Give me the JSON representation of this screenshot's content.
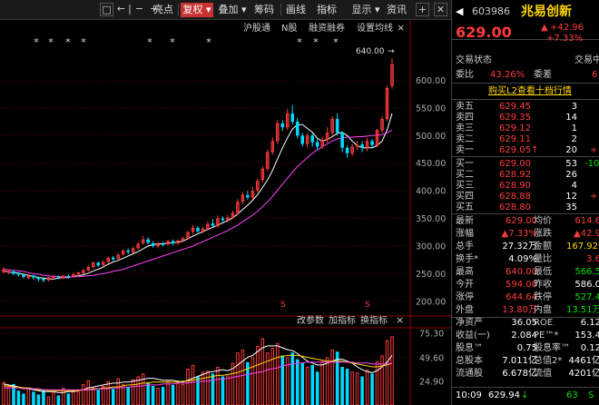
{
  "toolbar": {
    "nav_icons": [
      "□",
      "←",
      "|",
      "−",
      "+"
    ],
    "buttons": [
      "亮点",
      "复权 ▾",
      "叠加 ▾",
      "筹码",
      "画线",
      "指标",
      "显示 ▾",
      "资讯"
    ],
    "active_button": "复权 ▾",
    "plus_icon": "+",
    "close_icon": "✕"
  },
  "chart_header": {
    "stars": [
      "*",
      "*",
      "*",
      "*",
      "*",
      "*",
      "*",
      "*",
      "*",
      "*"
    ],
    "events": [
      "沪股通",
      "N股",
      "融资融券",
      "设置均线"
    ],
    "close_label": "×",
    "high_label": "640.00",
    "high_arrow": "→"
  },
  "indicator_menu": {
    "items": [
      "改参数",
      "加指标",
      "换指标"
    ],
    "close": "×"
  },
  "s_markers": [
    "S",
    "S"
  ],
  "colors": {
    "up": "#ff3b3b",
    "down": "#00d8ff",
    "ma5": "#ffffff",
    "ma10": "#ffd700",
    "ma20": "#ff40ff",
    "background": "#000000",
    "grid": "#8b0000"
  },
  "chart_data": {
    "type": "candlestick",
    "ylim": [
      175,
      660
    ],
    "price_ticks": [
      "600.00",
      "550.00",
      "500.00",
      "450.00",
      "400.00",
      "350.00",
      "300.00",
      "250.00",
      "200.00"
    ],
    "volume_ticks": [
      "75.30",
      "49.60",
      "24.90"
    ],
    "candles": [
      [
        253,
        258,
        250,
        262,
        0
      ],
      [
        252,
        255,
        249,
        258,
        0
      ],
      [
        254,
        250,
        247,
        257,
        1
      ],
      [
        251,
        248,
        245,
        253,
        1
      ],
      [
        248,
        244,
        241,
        250,
        1
      ],
      [
        242,
        246,
        240,
        249,
        0
      ],
      [
        247,
        243,
        239,
        248,
        1
      ],
      [
        243,
        240,
        236,
        245,
        1
      ],
      [
        241,
        238,
        234,
        243,
        1
      ],
      [
        238,
        243,
        236,
        245,
        0
      ],
      [
        243,
        245,
        239,
        248,
        0
      ],
      [
        245,
        243,
        240,
        247,
        1
      ],
      [
        242,
        246,
        240,
        248,
        0
      ],
      [
        246,
        245,
        241,
        249,
        1
      ],
      [
        245,
        249,
        243,
        252,
        0
      ],
      [
        249,
        252,
        246,
        254,
        0
      ],
      [
        251,
        256,
        249,
        259,
        0
      ],
      [
        256,
        262,
        254,
        265,
        0
      ],
      [
        262,
        270,
        259,
        272,
        0
      ],
      [
        270,
        265,
        262,
        272,
        1
      ],
      [
        266,
        271,
        263,
        274,
        0
      ],
      [
        271,
        279,
        269,
        281,
        0
      ],
      [
        279,
        276,
        273,
        282,
        1
      ],
      [
        277,
        284,
        275,
        288,
        0
      ],
      [
        285,
        292,
        283,
        294,
        0
      ],
      [
        292,
        289,
        286,
        296,
        1
      ],
      [
        289,
        296,
        287,
        299,
        0
      ],
      [
        296,
        304,
        294,
        307,
        0
      ],
      [
        305,
        312,
        302,
        318,
        0
      ],
      [
        312,
        306,
        303,
        316,
        1
      ],
      [
        305,
        300,
        297,
        309,
        1
      ],
      [
        300,
        304,
        296,
        307,
        0
      ],
      [
        304,
        302,
        299,
        308,
        1
      ],
      [
        303,
        309,
        301,
        311,
        0
      ],
      [
        309,
        305,
        301,
        312,
        1
      ],
      [
        305,
        310,
        302,
        312,
        0
      ],
      [
        310,
        314,
        307,
        317,
        0
      ],
      [
        314,
        325,
        312,
        328,
        0
      ],
      [
        326,
        333,
        322,
        338,
        0
      ],
      [
        333,
        327,
        324,
        336,
        1
      ],
      [
        327,
        331,
        323,
        335,
        0
      ],
      [
        331,
        340,
        328,
        345,
        0
      ],
      [
        341,
        337,
        334,
        349,
        1
      ],
      [
        336,
        350,
        333,
        355,
        0
      ],
      [
        350,
        347,
        343,
        354,
        1
      ],
      [
        347,
        352,
        343,
        356,
        0
      ],
      [
        352,
        360,
        349,
        364,
        0
      ],
      [
        360,
        380,
        357,
        385,
        0
      ],
      [
        381,
        393,
        375,
        398,
        0
      ],
      [
        392,
        388,
        384,
        400,
        1
      ],
      [
        388,
        400,
        384,
        407,
        0
      ],
      [
        401,
        418,
        397,
        422,
        0
      ],
      [
        420,
        440,
        415,
        445,
        0
      ],
      [
        440,
        470,
        436,
        475,
        0
      ],
      [
        470,
        490,
        465,
        497,
        0
      ],
      [
        490,
        522,
        485,
        528,
        0
      ],
      [
        522,
        515,
        508,
        528,
        1
      ],
      [
        515,
        540,
        510,
        548,
        0
      ],
      [
        540,
        525,
        520,
        555,
        1
      ],
      [
        525,
        500,
        495,
        532,
        1
      ],
      [
        500,
        485,
        480,
        505,
        1
      ],
      [
        485,
        500,
        478,
        505,
        0
      ],
      [
        500,
        488,
        480,
        504,
        1
      ],
      [
        488,
        480,
        474,
        494,
        1
      ],
      [
        480,
        492,
        476,
        498,
        0
      ],
      [
        492,
        505,
        487,
        515,
        0
      ],
      [
        505,
        530,
        500,
        535,
        0
      ],
      [
        530,
        505,
        500,
        540,
        1
      ],
      [
        505,
        478,
        470,
        508,
        1
      ],
      [
        478,
        468,
        460,
        482,
        1
      ],
      [
        468,
        480,
        463,
        485,
        0
      ],
      [
        480,
        483,
        474,
        490,
        0
      ],
      [
        484,
        478,
        470,
        490,
        1
      ],
      [
        478,
        490,
        472,
        496,
        0
      ],
      [
        490,
        483,
        477,
        494,
        1
      ],
      [
        482,
        510,
        479,
        512,
        0
      ],
      [
        510,
        530,
        505,
        535,
        0
      ],
      [
        530,
        586,
        526,
        590,
        0
      ],
      [
        590,
        629,
        585,
        640,
        0
      ]
    ],
    "volumes": [
      24,
      20,
      22,
      15,
      12,
      18,
      14,
      11,
      16,
      9,
      13,
      10,
      18,
      12,
      15,
      14,
      22,
      26,
      18,
      16,
      20,
      25,
      17,
      28,
      22,
      19,
      27,
      30,
      33,
      24,
      20,
      18,
      19,
      26,
      21,
      24,
      22,
      38,
      42,
      30,
      35,
      36,
      33,
      40,
      30,
      31,
      44,
      55,
      58,
      45,
      50,
      62,
      70,
      55,
      60,
      65,
      52,
      50,
      55,
      48,
      44,
      40,
      42,
      35,
      46,
      50,
      58,
      56,
      40,
      38,
      35,
      34,
      30,
      37,
      33,
      46,
      52,
      68,
      72
    ],
    "ma5": [
      255,
      253,
      252,
      251,
      249,
      247,
      245,
      243,
      242,
      241,
      240,
      242,
      243,
      243,
      245,
      246,
      248,
      251,
      255,
      258,
      262,
      267,
      271,
      274,
      278,
      282,
      286,
      290,
      295,
      300,
      303,
      304,
      304,
      305,
      306,
      307,
      309,
      313,
      318,
      322,
      326,
      330,
      334,
      338,
      342,
      346,
      351,
      358,
      366,
      374,
      383,
      393,
      406,
      420,
      437,
      458,
      478,
      496,
      512,
      520,
      520,
      513,
      506,
      495,
      490,
      493,
      498,
      504,
      506,
      500,
      490,
      482,
      478,
      478,
      478,
      482,
      490,
      510,
      540
    ],
    "ma20": [
      258,
      257,
      256,
      255,
      254,
      252,
      250,
      249,
      247,
      246,
      245,
      245,
      244,
      244,
      244,
      245,
      245,
      246,
      247,
      249,
      250,
      252,
      254,
      256,
      258,
      261,
      264,
      267,
      270,
      273,
      276,
      279,
      282,
      285,
      288,
      291,
      294,
      297,
      300,
      304,
      308,
      312,
      316,
      320,
      324,
      328,
      333,
      338,
      344,
      350,
      356,
      363,
      371,
      380,
      390,
      401,
      412,
      423,
      434,
      444,
      452,
      460,
      468,
      474,
      480,
      485,
      490,
      494,
      496,
      497,
      497,
      498,
      498,
      499,
      500,
      501,
      502,
      505,
      510
    ],
    "vol_ma1": [
      22,
      21,
      20,
      19,
      18,
      17,
      16,
      15,
      14,
      14,
      14,
      13,
      13,
      14,
      14,
      15,
      16,
      18,
      19,
      20,
      21,
      22,
      23,
      23,
      24,
      24,
      25,
      26,
      27,
      28,
      28,
      27,
      26,
      26,
      26,
      25,
      24,
      26,
      28,
      30,
      32,
      34,
      35,
      36,
      37,
      36,
      38,
      42,
      46,
      50,
      52,
      56,
      60,
      62,
      62,
      62,
      60,
      58,
      57,
      54,
      50,
      46,
      44,
      42,
      42,
      44,
      46,
      48,
      48,
      46,
      44,
      40,
      37,
      35,
      34,
      36,
      40,
      45,
      52
    ],
    "vol_ma2": [
      20,
      20,
      19,
      19,
      18,
      18,
      17,
      16,
      16,
      15,
      15,
      15,
      15,
      15,
      15,
      15,
      16,
      16,
      17,
      17,
      18,
      18,
      19,
      19,
      20,
      21,
      21,
      22,
      23,
      23,
      24,
      24,
      24,
      24,
      24,
      24,
      25,
      25,
      26,
      27,
      28,
      29,
      30,
      31,
      31,
      32,
      33,
      34,
      36,
      38,
      40,
      42,
      44,
      46,
      48,
      50,
      51,
      52,
      52,
      52,
      51,
      50,
      49,
      48,
      47,
      46,
      46,
      46,
      46,
      45,
      44,
      43,
      42,
      41,
      40,
      40,
      41,
      42,
      44
    ],
    "vol_ma3": [
      18,
      18,
      18,
      18,
      17,
      17,
      17,
      17,
      16,
      16,
      16,
      16,
      16,
      16,
      16,
      16,
      16,
      16,
      16,
      17,
      17,
      17,
      18,
      18,
      18,
      19,
      19,
      20,
      20,
      21,
      21,
      21,
      22,
      22,
      22,
      23,
      23,
      23,
      24,
      24,
      25,
      25,
      26,
      27,
      27,
      28,
      29,
      30,
      31,
      32,
      33,
      34,
      35,
      37,
      38,
      39,
      41,
      42,
      43,
      44,
      44,
      45,
      45,
      45,
      45,
      45,
      45,
      45,
      45,
      45,
      45,
      44,
      44,
      44,
      43,
      43,
      43,
      43,
      44
    ]
  },
  "quote": {
    "code": "603986",
    "name": "兆易创新",
    "price": "629.00",
    "change": "+42.96",
    "change_pct": "+7.33%",
    "arrow_up": "▲",
    "left_arrow": "◀",
    "status_row": {
      "left": "交易状态",
      "right": "交易中"
    },
    "ratio_row": {
      "l1": "委比",
      "v1": "43.26%",
      "l2": "委差",
      "v2": "6"
    },
    "promo": "购买L2查看十档行情",
    "asks": [
      {
        "label": "卖五",
        "price": "629.45",
        "vol": "3",
        "extra": ""
      },
      {
        "label": "卖四",
        "price": "629.35",
        "vol": "14",
        "extra": ""
      },
      {
        "label": "卖三",
        "price": "629.12",
        "vol": "1",
        "extra": ""
      },
      {
        "label": "卖二",
        "price": "629.11",
        "vol": "2",
        "extra": ""
      },
      {
        "label": "卖一",
        "price": "629.05↑",
        "vol": "20",
        "extra": "+"
      }
    ],
    "bids": [
      {
        "label": "买一",
        "price": "629.00",
        "vol": "53",
        "extra": "-10"
      },
      {
        "label": "买二",
        "price": "628.92",
        "vol": "26",
        "extra": ""
      },
      {
        "label": "买三",
        "price": "628.90",
        "vol": "4",
        "extra": ""
      },
      {
        "label": "买四",
        "price": "628.88",
        "vol": "12",
        "extra": "+"
      },
      {
        "label": "买五",
        "price": "628.80",
        "vol": "35",
        "extra": ""
      }
    ],
    "stats": [
      {
        "l1": "最新",
        "v1": "629.00",
        "l2": "均价",
        "v2": "614.6"
      },
      {
        "l1": "涨幅",
        "v1": "▲7.33%",
        "l2": "涨跌",
        "v2": "▲42.9"
      },
      {
        "l1": "总手",
        "v1": "27.32万",
        "l2": "金额",
        "v2": "167.92亿"
      },
      {
        "l1": "换手*",
        "v1": "4.09%",
        "l2": "量比",
        "v2": "3.6"
      },
      {
        "l1": "最高",
        "v1": "640.00",
        "l2": "最低",
        "v2": "566.5"
      },
      {
        "l1": "今开",
        "v1": "594.00",
        "l2": "昨收",
        "v2": "586.0"
      },
      {
        "l1": "涨停",
        "v1": "644.64",
        "l2": "跌停",
        "v2": "527.4"
      },
      {
        "l1": "外盘",
        "v1": "13.80万",
        "l2": "内盘",
        "v2": "13.51万"
      },
      {
        "l1": "净资产",
        "v1": "36.05",
        "l2": "ROE",
        "v2": "6.12"
      },
      {
        "l1": "收益(一)",
        "v1": "2.084",
        "l2": "PE™*",
        "v2": "153.4"
      },
      {
        "l1": "股息™",
        "v1": "0.75",
        "l2": "股息率™",
        "v2": "0.12"
      },
      {
        "l1": "总股本",
        "v1": "7.011亿",
        "l2": "总值2*",
        "v2": "4461亿"
      },
      {
        "l1": "流通股",
        "v1": "6.678亿",
        "l2": "流值",
        "v2": "4201亿"
      }
    ],
    "footer": {
      "time": "10:09",
      "price": "629.94",
      "arrow": "↓",
      "vol": "63",
      "flag": "S"
    }
  }
}
